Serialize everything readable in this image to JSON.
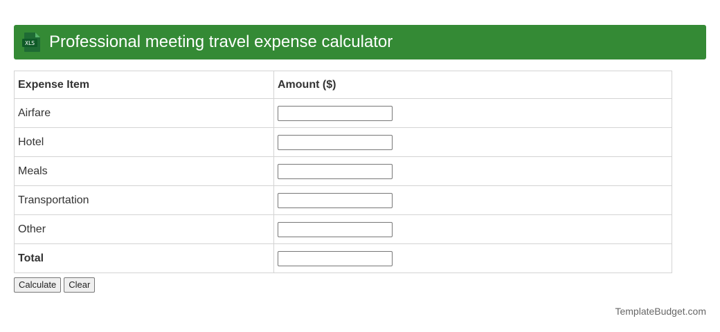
{
  "header": {
    "icon": "xls-file-icon",
    "icon_text": "XLS",
    "title": "Professional meeting travel expense calculator",
    "background": "#348a35"
  },
  "table": {
    "headers": [
      "Expense Item",
      "Amount ($)"
    ],
    "rows": [
      {
        "label": "Airfare",
        "value": ""
      },
      {
        "label": "Hotel",
        "value": ""
      },
      {
        "label": "Meals",
        "value": ""
      },
      {
        "label": "Transportation",
        "value": ""
      },
      {
        "label": "Other",
        "value": ""
      }
    ],
    "total": {
      "label": "Total",
      "value": ""
    }
  },
  "buttons": {
    "calculate": "Calculate",
    "clear": "Clear"
  },
  "footer": {
    "brand": "TemplateBudget.com"
  }
}
